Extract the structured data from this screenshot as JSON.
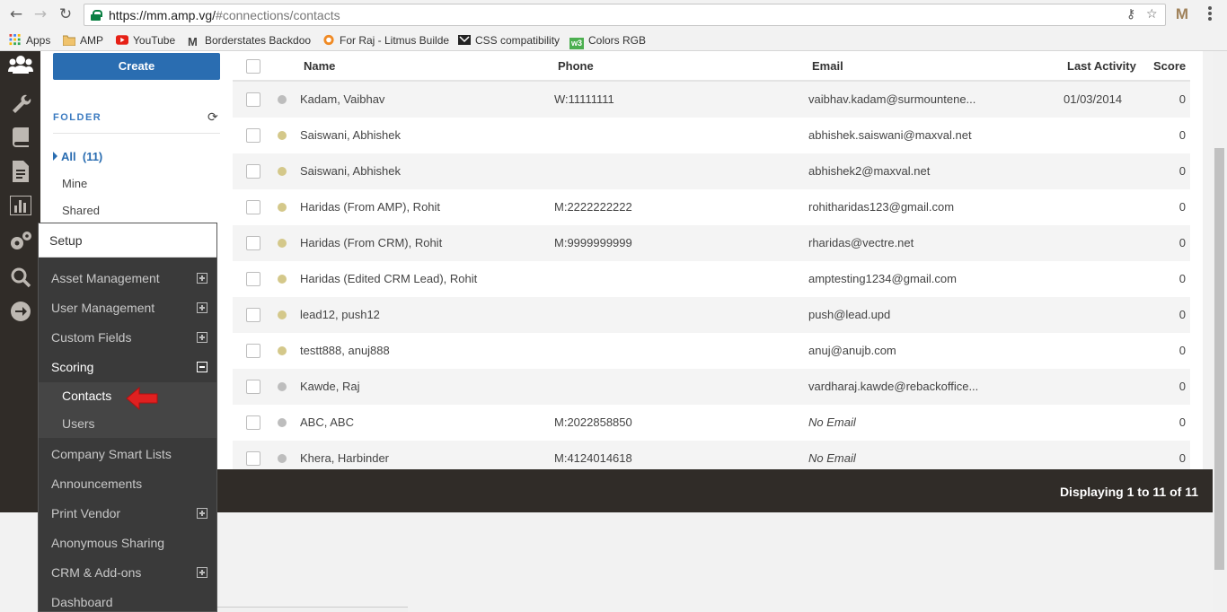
{
  "browser": {
    "url_host": "https://mm.amp.vg/",
    "url_path": "#connections/contacts",
    "back_icon": "back-arrow-icon",
    "forward_icon": "forward-arrow-icon",
    "reload_icon": "reload-icon",
    "extension_label": "M"
  },
  "bookmarks": [
    {
      "label": "Apps",
      "icon": "apps-grid-icon"
    },
    {
      "label": "AMP",
      "icon": "folder-icon"
    },
    {
      "label": "YouTube",
      "icon": "youtube-icon"
    },
    {
      "label": "Borderstates Backdoo",
      "icon": "m-logo-icon"
    },
    {
      "label": "For Raj - Litmus Builde",
      "icon": "litmus-icon"
    },
    {
      "label": "CSS compatibility",
      "icon": "css-icon"
    },
    {
      "label": "Colors RGB",
      "icon": "w3-icon"
    }
  ],
  "sidebar": {
    "create_label": "Create",
    "folder_title": "FOLDER",
    "all_label": "All",
    "all_count": "(11)",
    "items": [
      "Mine",
      "Shared"
    ]
  },
  "table": {
    "columns": {
      "name": "Name",
      "phone": "Phone",
      "email": "Email",
      "last_activity": "Last Activity",
      "score": "Score"
    },
    "rows": [
      {
        "name": "Kadam, Vaibhav",
        "phone": "W:11111111",
        "email": "vaibhav.kadam@surmountene...",
        "email_italic": false,
        "last_activity": "01/03/2014",
        "score": "0",
        "status_color": "#bdbdbd"
      },
      {
        "name": "Saiswani, Abhishek",
        "phone": "",
        "email": "abhishek.saiswani@maxval.net",
        "email_italic": false,
        "last_activity": "",
        "score": "0",
        "status_color": "#d4c88a"
      },
      {
        "name": "Saiswani, Abhishek",
        "phone": "",
        "email": "abhishek2@maxval.net",
        "email_italic": false,
        "last_activity": "",
        "score": "0",
        "status_color": "#d4c88a"
      },
      {
        "name": "Haridas (From AMP), Rohit",
        "phone": "M:2222222222",
        "email": "rohitharidas123@gmail.com",
        "email_italic": false,
        "last_activity": "",
        "score": "0",
        "status_color": "#d4c88a"
      },
      {
        "name": "Haridas (From CRM), Rohit",
        "phone": "M:9999999999",
        "email": "rharidas@vectre.net",
        "email_italic": false,
        "last_activity": "",
        "score": "0",
        "status_color": "#d4c88a"
      },
      {
        "name": "Haridas (Edited CRM Lead), Rohit",
        "phone": "",
        "email": "amptesting1234@gmail.com",
        "email_italic": false,
        "last_activity": "",
        "score": "0",
        "status_color": "#d4c88a"
      },
      {
        "name": "lead12, push12",
        "phone": "",
        "email": "push@lead.upd",
        "email_italic": false,
        "last_activity": "",
        "score": "0",
        "status_color": "#d4c88a"
      },
      {
        "name": "testt888, anuj888",
        "phone": "",
        "email": "anuj@anujb.com",
        "email_italic": false,
        "last_activity": "",
        "score": "0",
        "status_color": "#d4c88a"
      },
      {
        "name": "Kawde, Raj",
        "phone": "",
        "email": "vardharaj.kawde@rebackoffice...",
        "email_italic": false,
        "last_activity": "",
        "score": "0",
        "status_color": "#bdbdbd"
      },
      {
        "name": "ABC, ABC",
        "phone": "M:2022858850",
        "email": "No Email",
        "email_italic": true,
        "last_activity": "",
        "score": "0",
        "status_color": "#bdbdbd"
      },
      {
        "name": "Khera, Harbinder",
        "phone": "M:4124014618",
        "email": "No Email",
        "email_italic": true,
        "last_activity": "",
        "score": "0",
        "status_color": "#bdbdbd"
      }
    ]
  },
  "footer": {
    "displaying": "Displaying 1 to 11 of 11"
  },
  "setup_menu": {
    "title": "Setup",
    "items": [
      {
        "label": "Asset Management",
        "expander": "plus"
      },
      {
        "label": "User Management",
        "expander": "plus"
      },
      {
        "label": "Custom Fields",
        "expander": "plus"
      },
      {
        "label": "Scoring",
        "expander": "minus",
        "open": true,
        "children": [
          "Contacts",
          "Users"
        ]
      },
      {
        "label": "Company Smart Lists",
        "expander": ""
      },
      {
        "label": "Announcements",
        "expander": ""
      },
      {
        "label": "Print Vendor",
        "expander": "plus"
      },
      {
        "label": "Anonymous Sharing",
        "expander": ""
      },
      {
        "label": "CRM & Add-ons",
        "expander": "plus"
      },
      {
        "label": "Dashboard",
        "expander": ""
      }
    ]
  },
  "colors": {
    "accent": "#2a6db1",
    "rail": "#302c28",
    "menu_bg": "#3a3a3a",
    "arrow": "#e02020"
  }
}
